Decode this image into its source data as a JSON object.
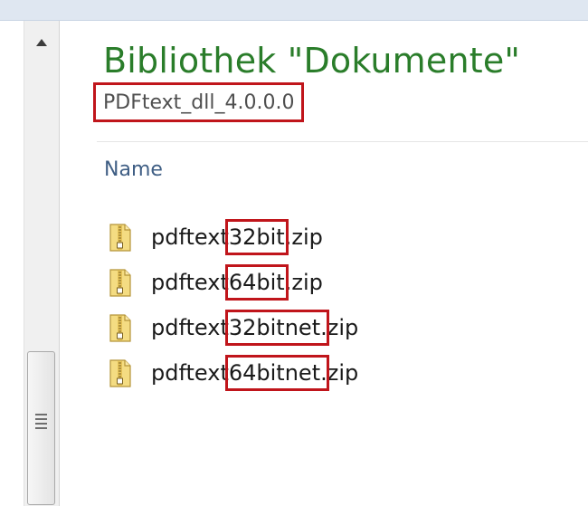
{
  "library": {
    "title": "Bibliothek \"Dokumente\"",
    "subtitle": "PDFtext_dll_4.0.0.0"
  },
  "list": {
    "column_header": "Name",
    "files": [
      {
        "name": "pdftext32bit.zip",
        "icon": "zip-folder-icon",
        "highlighted": "32bit"
      },
      {
        "name": "pdftext64bit.zip",
        "icon": "zip-folder-icon",
        "highlighted": "64bit"
      },
      {
        "name": "pdftext32bitnet.zip",
        "icon": "zip-folder-icon",
        "highlighted": "32bitnet"
      },
      {
        "name": "pdftext64bitnet.zip",
        "icon": "zip-folder-icon",
        "highlighted": "64bitnet"
      }
    ]
  },
  "colors": {
    "title_green": "#2a7d2a",
    "highlight_red": "#c0151b",
    "header_blue": "#3f5e84"
  }
}
